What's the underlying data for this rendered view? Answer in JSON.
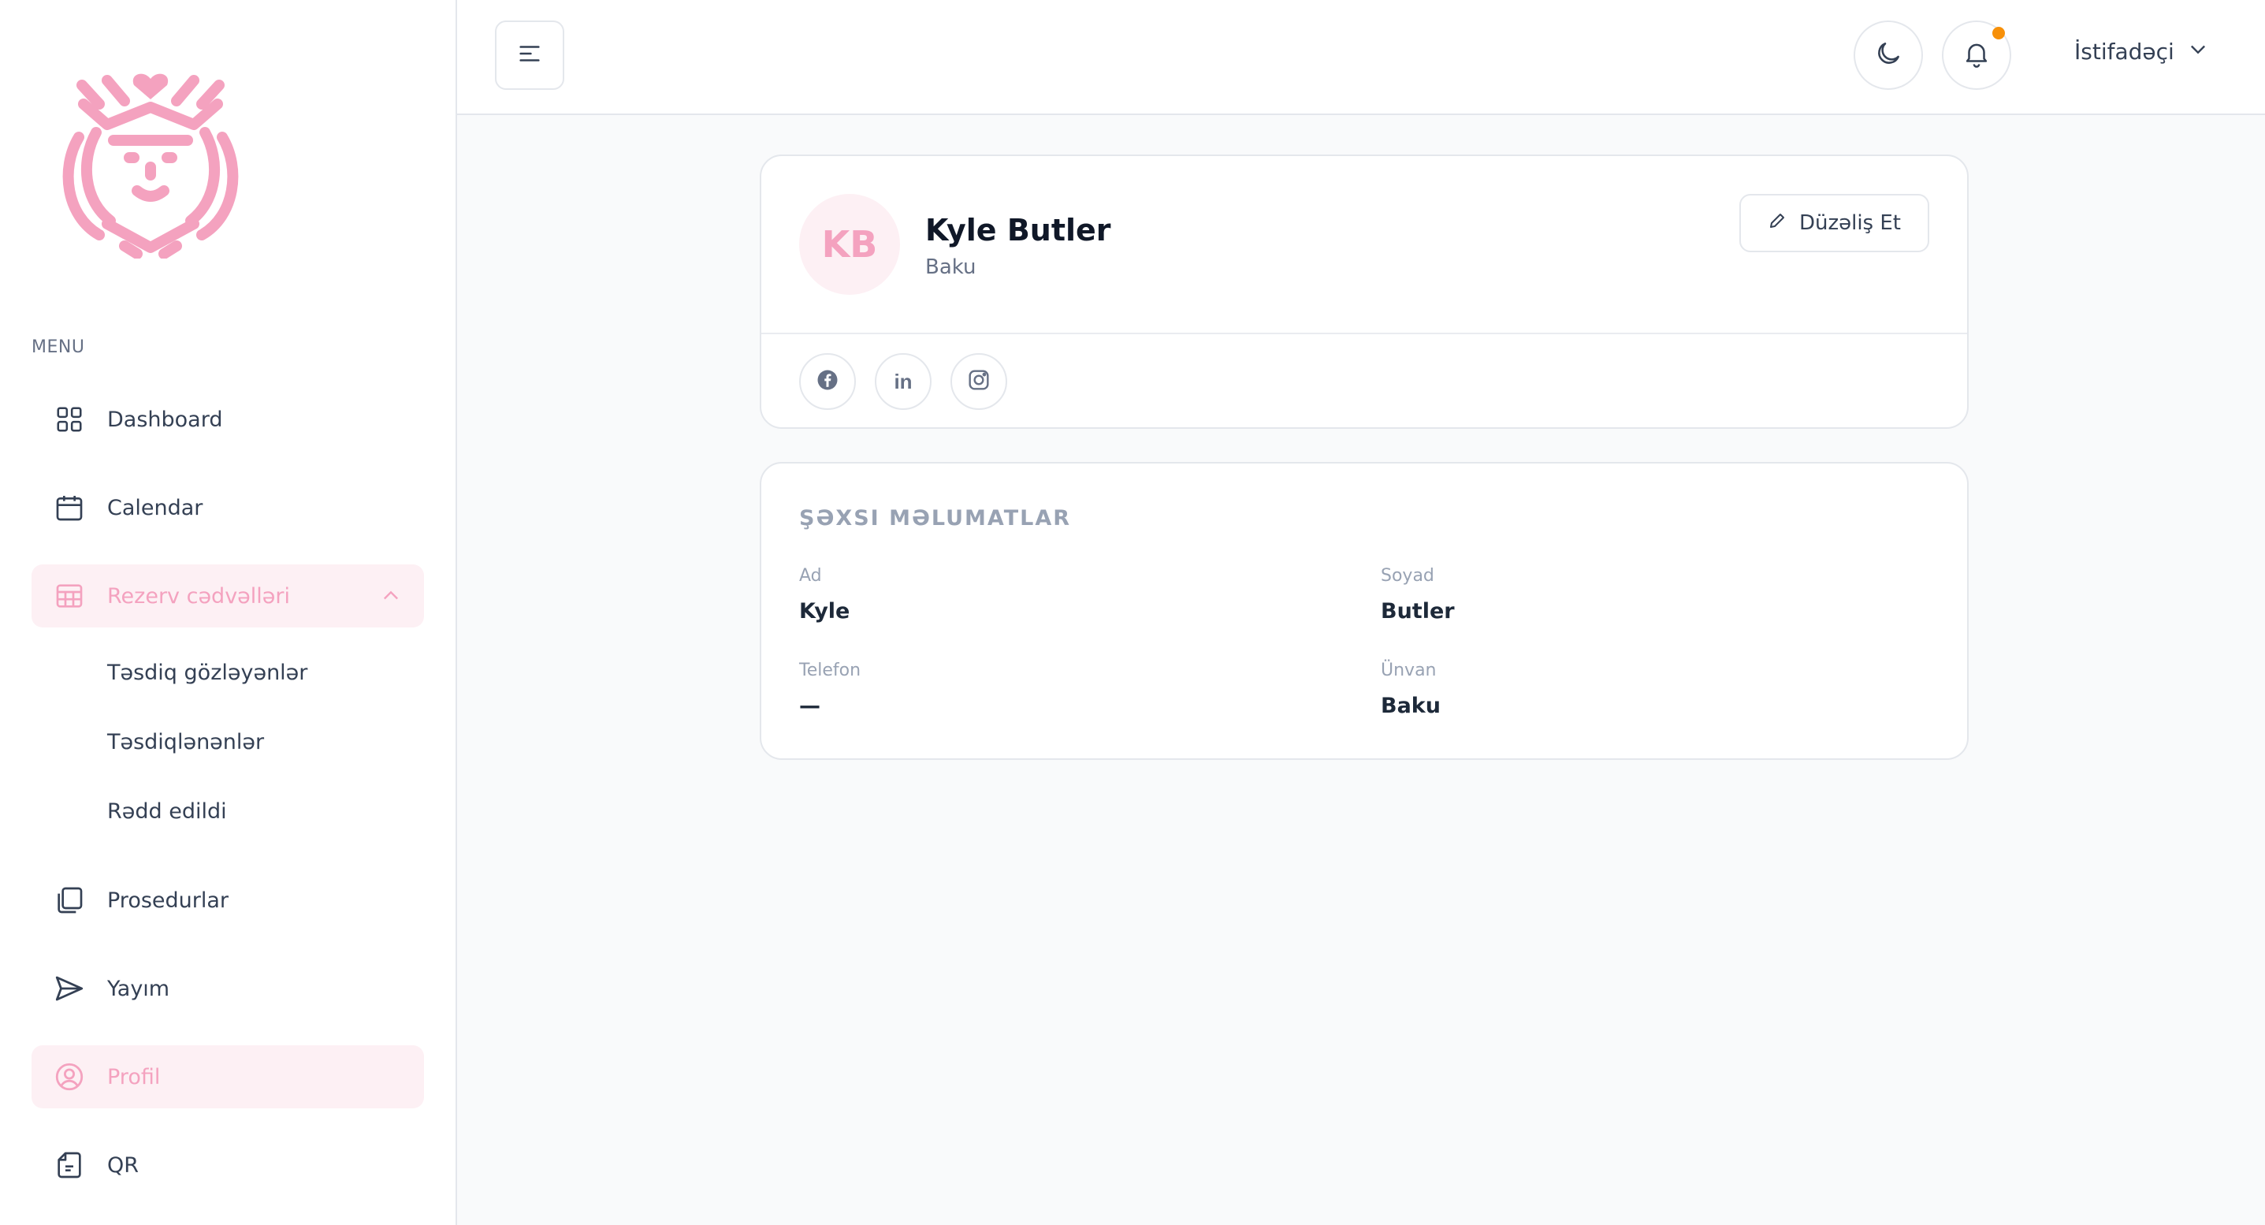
{
  "sidebar": {
    "menu_heading": "MENU",
    "items": {
      "dashboard": "Dashboard",
      "calendar": "Calendar",
      "reservations": "Rezerv cədvəlləri",
      "procedures": "Prosedurlar",
      "broadcast": "Yayım",
      "profile": "Profil",
      "qr": "QR"
    },
    "reservation_sub": [
      "Təsdiq gözləyənlər",
      "Təsdiqlənənlər",
      "Rədd edildi"
    ]
  },
  "header": {
    "user_label": "İstifadəçi"
  },
  "profile": {
    "initials": "KB",
    "name": "Kyle Butler",
    "city": "Baku",
    "edit_label": "Düzəliş Et"
  },
  "personal_info": {
    "title": "ŞƏXSI MƏLUMATLAR",
    "first_name_label": "Ad",
    "first_name": "Kyle",
    "last_name_label": "Soyad",
    "last_name": "Butler",
    "phone_label": "Telefon",
    "phone": "—",
    "address_label": "Ünvan",
    "address": "Baku"
  },
  "colors": {
    "accent": "#f4a2bf",
    "accent_bg": "#fdf0f4",
    "notification": "#f79009"
  },
  "icons": {
    "dashboard": "grid-icon",
    "calendar": "calendar-icon",
    "reservations": "table-icon",
    "procedures": "copy-icon",
    "broadcast": "send-icon",
    "profile": "user-circle-icon",
    "qr": "document-icon"
  }
}
